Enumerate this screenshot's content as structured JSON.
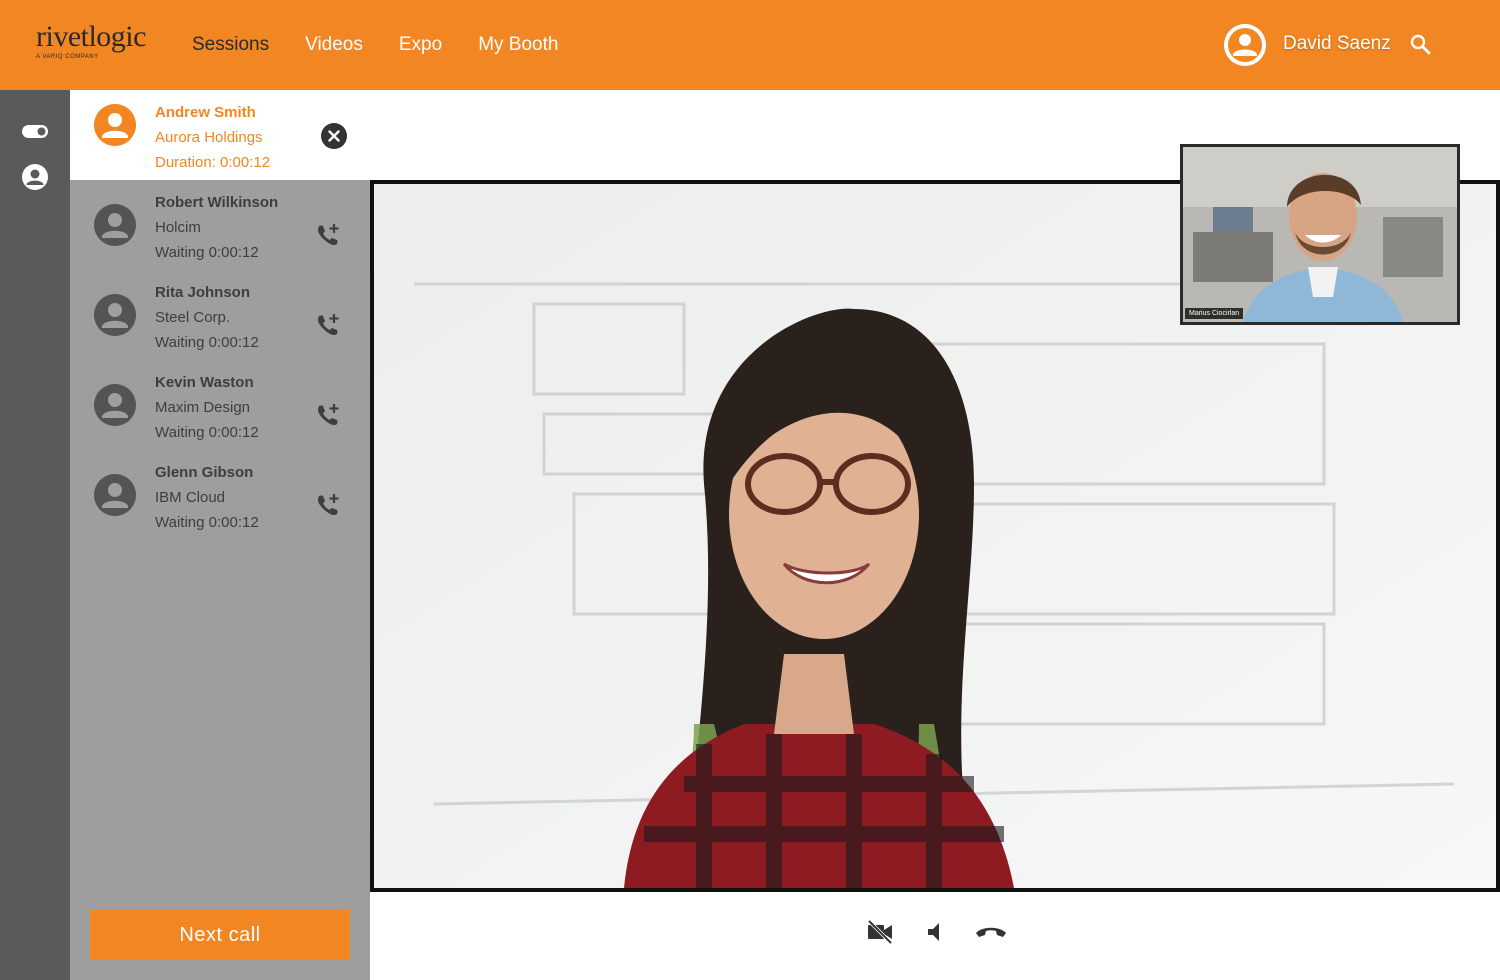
{
  "header": {
    "logo_text": "rivetlogic",
    "logo_sub": "A VARIQ COMPANY",
    "nav": [
      {
        "label": "Sessions",
        "active": true
      },
      {
        "label": "Videos",
        "active": false
      },
      {
        "label": "Expo",
        "active": false
      },
      {
        "label": "My Booth",
        "active": false
      }
    ],
    "user_name": "David Saenz"
  },
  "active_call": {
    "name": "Andrew Smith",
    "company": "Aurora Holdings",
    "duration": "Duration: 0:00:12"
  },
  "queue": [
    {
      "name": "Robert Wilkinson",
      "company": "Holcim",
      "status": "Waiting 0:00:12"
    },
    {
      "name": "Rita Johnson",
      "company": "Steel Corp.",
      "status": "Waiting 0:00:12"
    },
    {
      "name": "Kevin Waston",
      "company": "Maxim Design",
      "status": "Waiting 0:00:12"
    },
    {
      "name": "Glenn Gibson",
      "company": "IBM Cloud",
      "status": "Waiting 0:00:12"
    }
  ],
  "next_call_label": "Next call",
  "self_video_label": "Marius Ciocirlan",
  "colors": {
    "brand": "#f28622",
    "rail": "#5a5a5a",
    "panel": "#9e9e9e"
  },
  "icons": {
    "search": "search-icon",
    "toggle": "toggle-icon",
    "user": "user-icon",
    "close": "close-circle-icon",
    "add_call": "add-call-icon",
    "video_off": "video-off-icon",
    "volume": "volume-icon",
    "hang_up": "hang-up-icon"
  }
}
